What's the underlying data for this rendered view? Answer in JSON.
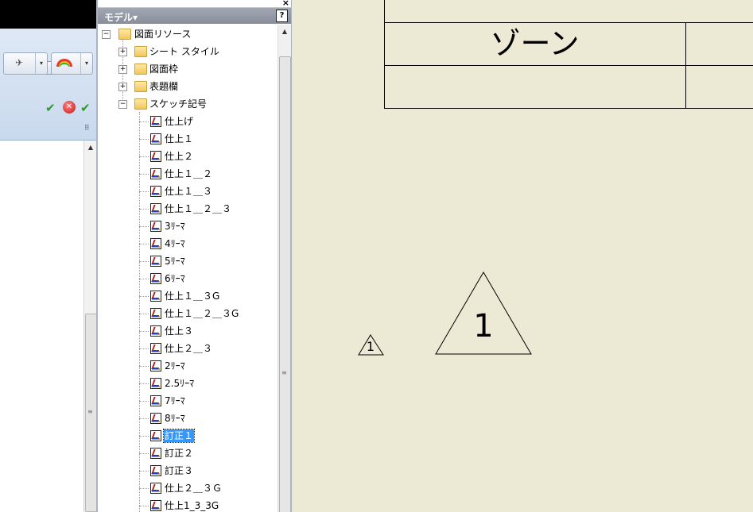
{
  "tree_panel": {
    "title": "モデル▾",
    "help_label": "?",
    "close_label": "×",
    "root": "図面リソース",
    "groups": [
      "シート スタイル",
      "図面枠",
      "表題欄",
      "スケッチ記号"
    ],
    "expanders": {
      "root": "−",
      "collapsed": "+",
      "expanded": "−"
    },
    "sketch_symbols": [
      "仕上げ",
      "仕上１",
      "仕上２",
      "仕上１＿２",
      "仕上１＿３",
      "仕上１＿２＿３",
      "3ﾘｰﾏ",
      "4ﾘｰﾏ",
      "5ﾘｰﾏ",
      "6ﾘｰﾏ",
      "仕上１＿３G",
      "仕上１＿２＿３G",
      "仕上３",
      "仕上２＿３",
      "2ﾘｰﾏ",
      "2.5ﾘｰﾏ",
      "7ﾘｰﾏ",
      "8ﾘｰﾏ",
      "訂正１",
      "訂正２",
      "訂正３",
      "仕上２＿３Ｇ",
      "仕上1_3_3G"
    ],
    "selected_item": "訂正１"
  },
  "drawing": {
    "zone_label": "ゾーン",
    "big_triangle_number": "1",
    "small_triangle_number": "1"
  },
  "toolbar": {
    "dropdown_arrow": "▾",
    "scroll_up": "▲",
    "grip": "⠿"
  },
  "colors": {
    "drawing_background": "#ecead5",
    "selection": "#3399ff",
    "panel_header": "#878e9a"
  }
}
